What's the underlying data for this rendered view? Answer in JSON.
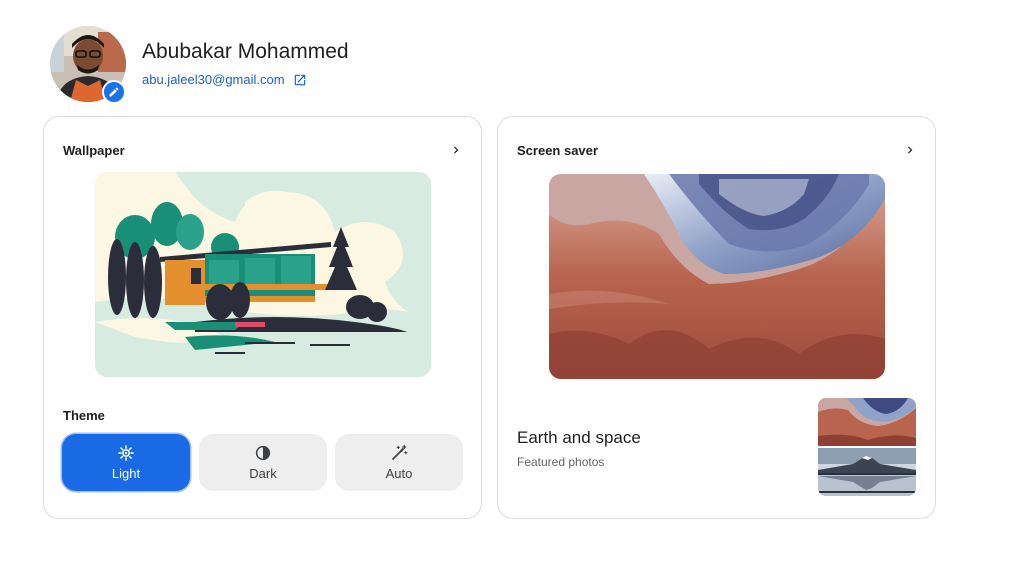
{
  "profile": {
    "name": "Abubakar Mohammed",
    "email": "abu.jaleel30@gmail.com",
    "avatar_icon": "person-photo",
    "edit_icon": "pencil-icon",
    "external_link_icon": "open-in-new-icon"
  },
  "wallpaper": {
    "title": "Wallpaper",
    "chevron_icon": "chevron-right-icon"
  },
  "theme": {
    "label": "Theme",
    "options": [
      {
        "label": "Light",
        "icon": "sun-icon",
        "selected": true
      },
      {
        "label": "Dark",
        "icon": "contrast-icon",
        "selected": false
      },
      {
        "label": "Auto",
        "icon": "magic-wand-icon",
        "selected": false
      }
    ]
  },
  "screensaver": {
    "title": "Screen saver",
    "chevron_icon": "chevron-right-icon",
    "album_title": "Earth and space",
    "album_subtitle": "Featured photos"
  },
  "colors": {
    "accent": "#1a6ae6",
    "link": "#1a5fc7",
    "card_border": "#dadce0",
    "button_bg": "#eeeeee"
  }
}
